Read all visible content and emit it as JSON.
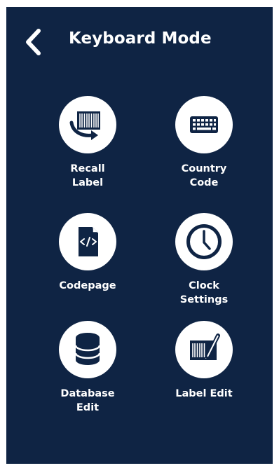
{
  "header": {
    "back_icon": "chevron-left-icon",
    "title": "Keyboard Mode"
  },
  "tiles": [
    {
      "label": "Recall\nLabel",
      "icon": "recall-label-icon"
    },
    {
      "label": "Country\nCode",
      "icon": "keyboard-icon"
    },
    {
      "label": "Codepage",
      "icon": "codepage-file-icon"
    },
    {
      "label": "Clock\nSettings",
      "icon": "clock-icon"
    },
    {
      "label": "Database\nEdit",
      "icon": "database-icon"
    },
    {
      "label": "Label Edit",
      "icon": "label-edit-icon"
    }
  ],
  "colors": {
    "background": "#0f2444",
    "icon_circle": "#ffffff",
    "text": "#ffffff"
  }
}
